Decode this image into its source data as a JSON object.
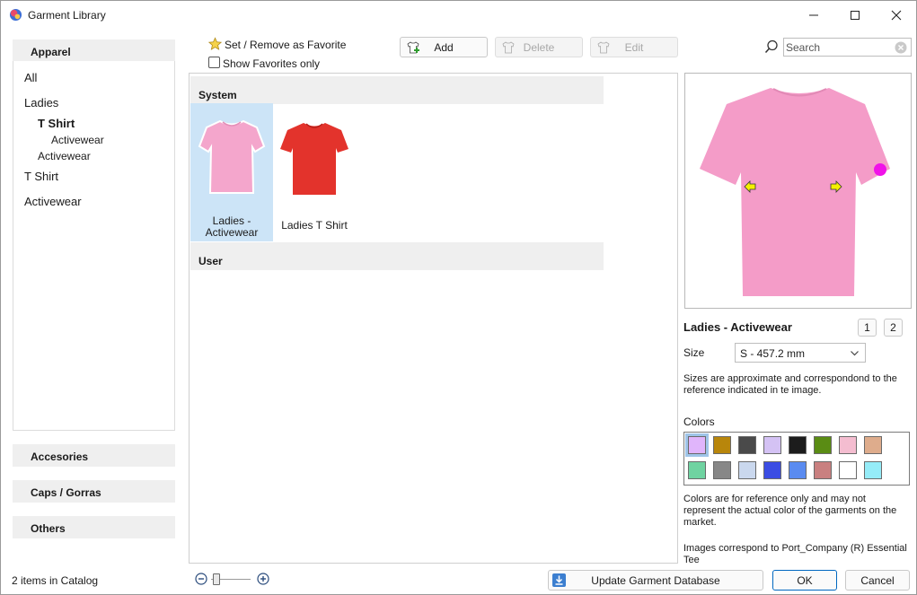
{
  "window": {
    "title": "Garment Library",
    "minimize_icon": "minimize-icon",
    "maximize_icon": "maximize-icon",
    "close_icon": "close-icon"
  },
  "left_panel": {
    "apparel_header": "Apparel",
    "tree": [
      {
        "label": "All",
        "level": 0,
        "bold": false
      },
      {
        "label": "Ladies",
        "level": 0,
        "bold": false
      },
      {
        "label": "T Shirt",
        "level": 1,
        "bold": true
      },
      {
        "label": "Activewear",
        "level": 2,
        "bold": false
      },
      {
        "label": "Activewear",
        "level": 1,
        "bold": false
      },
      {
        "label": "T Shirt",
        "level": 0,
        "bold": false
      },
      {
        "label": "Activewear",
        "level": 0,
        "bold": false
      }
    ],
    "sections": [
      "Accesories",
      "Caps / Gorras",
      "Others"
    ]
  },
  "toolbar": {
    "favorite_label": "Set / Remove as Favorite",
    "show_favorites_label": "Show Favorites only",
    "show_favorites_checked": false,
    "add_label": "Add",
    "delete_label": "Delete",
    "edit_label": "Edit",
    "search_placeholder": "Search"
  },
  "catalog": {
    "groups": [
      "System",
      "User"
    ],
    "items": [
      {
        "label": "Ladies - Activewear",
        "color": "#f09ac4",
        "selected": true
      },
      {
        "label": "Ladies T Shirt",
        "color": "#e2312b",
        "selected": false
      }
    ]
  },
  "details": {
    "garment_name": "Ladies - Activewear",
    "view_buttons": [
      "1",
      "2"
    ],
    "size_label": "Size",
    "size_value": "S - 457.2 mm",
    "size_note": "Sizes are approximate and correspondond to the reference indicated in te image.",
    "colors_label": "Colors",
    "colors": [
      "#e0b5fb",
      "#b8860b",
      "#4a4a4a",
      "#d4c2f4",
      "#1c1c1c",
      "#5a8c14",
      "#f4bdd0",
      "#deac8c",
      "#6fd3a1",
      "#878787",
      "#cad8ee",
      "#3b4de3",
      "#5a8bf0",
      "#c98080",
      "#ffffff",
      "#95ecf8"
    ],
    "selected_color_index": 0,
    "color_note": "Colors are for reference only and may not represent the actual color of the garments on the market.",
    "image_note": "Images correspond to Port_Company (R) Essential Tee",
    "preview_color": "#f49cc8"
  },
  "status_bar": {
    "items_text": "2 items in Catalog",
    "update_label": "Update Garment Database",
    "ok_label": "OK",
    "cancel_label": "Cancel"
  }
}
